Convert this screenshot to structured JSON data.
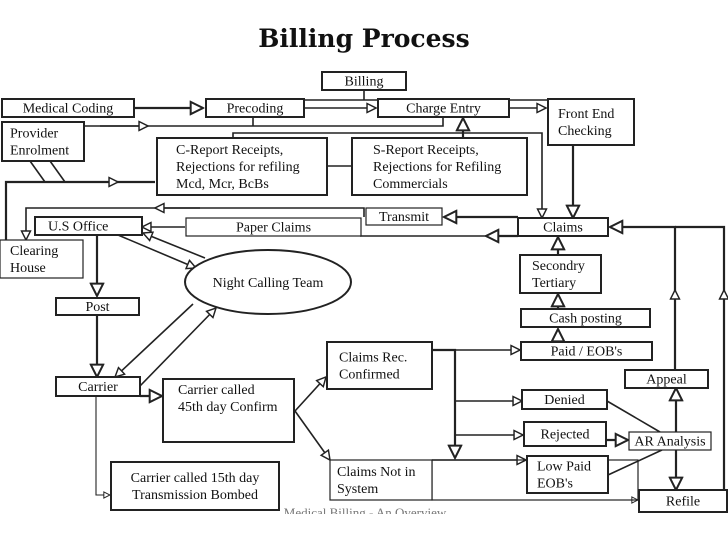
{
  "title": "Billing Process",
  "footer": "Medical Billing - An Overview",
  "nodes": {
    "billing": [
      "Billing"
    ],
    "medical_coding": [
      "Medical Coding"
    ],
    "precoding": [
      "Precoding"
    ],
    "charge_entry": [
      "Charge Entry"
    ],
    "front_end_checking": [
      "Front End",
      "Checking"
    ],
    "provider_enrolment": [
      "Provider",
      "Enrolment"
    ],
    "c_report": [
      "C-Report Receipts,",
      "Rejections for refiling",
      "Mcd, Mcr, BcBs"
    ],
    "s_report": [
      "S-Report Receipts,",
      "Rejections for Refiling",
      "Commercials"
    ],
    "transmit": [
      "Transmit"
    ],
    "us_office": [
      "U.S Office"
    ],
    "paper_claims": [
      "Paper Claims"
    ],
    "claims": [
      "Claims"
    ],
    "clearing_house": [
      "Clearing",
      "House"
    ],
    "night_calling_team": [
      "Night Calling Team"
    ],
    "secondary_tertiary": [
      "Secondry",
      "Tertiary"
    ],
    "post": [
      "Post"
    ],
    "cash_posting": [
      "Cash posting"
    ],
    "paid_eobs": [
      "Paid / EOB's"
    ],
    "claims_rec_confirmed": [
      "Claims  Rec.",
      "Confirmed"
    ],
    "appeal": [
      "Appeal"
    ],
    "carrier": [
      "Carrier"
    ],
    "carrier_called_45": [
      "Carrier called",
      "45th day Confirm"
    ],
    "denied": [
      "Denied"
    ],
    "rejected": [
      "Rejected"
    ],
    "ar_analysis": [
      "AR Analysis"
    ],
    "claims_not_in_system": [
      "Claims Not in",
      "System"
    ],
    "low_paid_eobs": [
      "Low Paid",
      "EOB's"
    ],
    "carrier_called_15": [
      "Carrier called 15th day",
      "Transmission Bombed"
    ],
    "refile": [
      "Refile"
    ]
  }
}
